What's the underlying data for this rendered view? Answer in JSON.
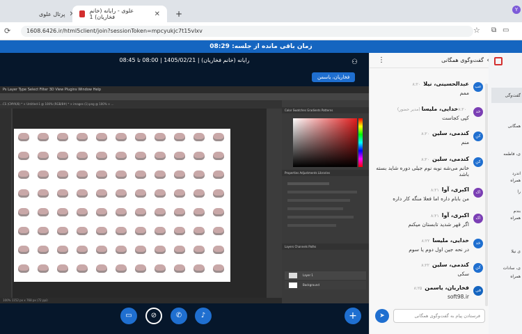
{
  "browser": {
    "tabs": [
      {
        "label": "پرتال علوی"
      },
      {
        "label": "علوی - رایانه (خانم فخاریان) 1"
      }
    ],
    "new_tab": "+",
    "url": "1608.6426.ir/html5client/join?sessionToken=mpcyukjc7t15vlxv"
  },
  "meeting": {
    "timer_label": "زمان باقی مانده از جلسه:",
    "timer_value": "08:29",
    "info": "رایانه (خانم فخاریان) | 1405/02/21 | 08:00 تا 08:45",
    "presenter": "فخاریان، یاسمن"
  },
  "photoshop": {
    "menu": "Ps  Layer  Type  Select  Filter  3D  View  Plugins  Window  Help",
    "tabs": "…CS (CMYK/8) *  ×    Untitled-1 @ 100% (RGB/8#) *  ×    images (1).png @ 100% ×    …",
    "status": "100%    1152 px x 768 px (72 ppi)",
    "panels": {
      "color": "Color   Swatches   Gradients   Patterns",
      "properties": "Properties   Adjustments   Libraries",
      "layers": "Layers   Channels   Paths"
    },
    "layer_names": [
      "Layer 1",
      "Background"
    ]
  },
  "chat": {
    "header": "گفت‌وگوی همگانی",
    "messages": [
      {
        "initials": "عب",
        "name": "عبدالحسینی، نیلا",
        "time": "۸:۲۰",
        "text": "ممم",
        "color": "#1f6fd0"
      },
      {
        "initials": "خد",
        "name": "خدایی، ملیسا",
        "time": "(مدیر حضور) ۸:۲۰",
        "text": "کپی کجاست",
        "color": "#7b3fb4"
      },
      {
        "initials": "کن",
        "name": "کندمی، سلین",
        "time": "۸:۲۰",
        "text": "منم",
        "color": "#1f6fd0"
      },
      {
        "initials": "کن",
        "name": "کندمی، سلین",
        "time": "۸:۲۰",
        "text": "خانم می‌شه نوبه نوم جیلی دوره شاید بسته باشد",
        "color": "#1f6fd0"
      },
      {
        "initials": "اک",
        "name": "اکبری، آوا",
        "time": "۸:۲۱",
        "text": "من بابام داره اما فعلا منگه کار داره",
        "color": "#7b3fb4"
      },
      {
        "initials": "اک",
        "name": "اکبری، آوا",
        "time": "۸:۲۱",
        "text": "اگر قهر شدید تابستان میکنم",
        "color": "#7b3fb4"
      },
      {
        "initials": "خد",
        "name": "خدایی، ملیسا",
        "time": "۸:۲۲",
        "text": "در نحه جین اول دوم یا سوم",
        "color": "#1f6fd0"
      },
      {
        "initials": "کن",
        "name": "کندمی، سلین",
        "time": "۸:۲۲",
        "text": "سکی",
        "color": "#1f6fd0"
      },
      {
        "initials": "فی",
        "name": "فخاریان، یاسمن",
        "time": "۸:۲۵",
        "text": "soft98.ir",
        "color": "#1565c0"
      }
    ],
    "input_placeholder": "فرستادن پیام به گفت‌وگوی همگانی"
  },
  "users_panel": {
    "items": [
      "گفت‌وگی",
      "همگانی",
      "ی، فاطمه",
      "اندرد",
      "همراه",
      "را",
      "بندم",
      "همراه",
      "ی نیلا",
      "ی، سادات",
      "همراه"
    ]
  }
}
